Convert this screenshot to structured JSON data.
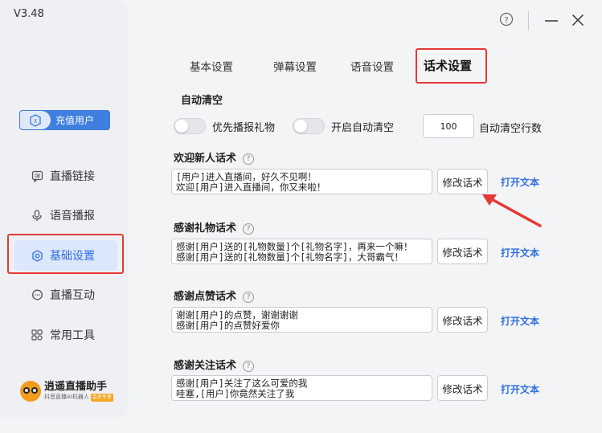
{
  "app": {
    "version": "V3.48"
  },
  "sidebar": {
    "vip_label": "充值用户",
    "items": [
      {
        "label": "直播链接",
        "icon": "chat-bubble-icon"
      },
      {
        "label": "语音播报",
        "icon": "microphone-icon"
      },
      {
        "label": "基础设置",
        "icon": "settings-icon",
        "active": true
      },
      {
        "label": "直播互动",
        "icon": "chat-icon"
      },
      {
        "label": "常用工具",
        "icon": "apps-icon"
      }
    ],
    "logo_name": "逍遥直播助手",
    "logo_sub": "抖音直播AI机器人",
    "logo_tag": "会员专享"
  },
  "tabs": [
    "基本设置",
    "弹幕设置",
    "语音设置",
    "话术设置"
  ],
  "auto_clear": {
    "title": "自动清空",
    "toggle1_label": "优先播报礼物",
    "toggle2_label": "开启自动清空",
    "count_value": "100",
    "count_label": "自动清空行数"
  },
  "sections": [
    {
      "title": "欢迎新人话术",
      "text": "[用户]进入直播间，好久不见啊！\n欢迎[用户]进入直播间，你又来啦！"
    },
    {
      "title": "感谢礼物话术",
      "text": "感谢[用户]送的[礼物数量]个[礼物名字]，再来一个嘛！\n感谢[用户]送的[礼物数量]个[礼物名字]，大哥霸气！"
    },
    {
      "title": "感谢点赞话术",
      "text": "谢谢[用户]的点赞，谢谢谢谢\n感谢[用户]的点赞好爱你"
    },
    {
      "title": "感谢关注话术",
      "text": "感谢[用户]关注了这么可爱的我\n哇塞,[用户]你竟然关注了我"
    }
  ],
  "buttons": {
    "edit": "修改话术",
    "open": "打开文本"
  },
  "colors": {
    "accent": "#2f6ee0",
    "highlight": "#e53935"
  }
}
